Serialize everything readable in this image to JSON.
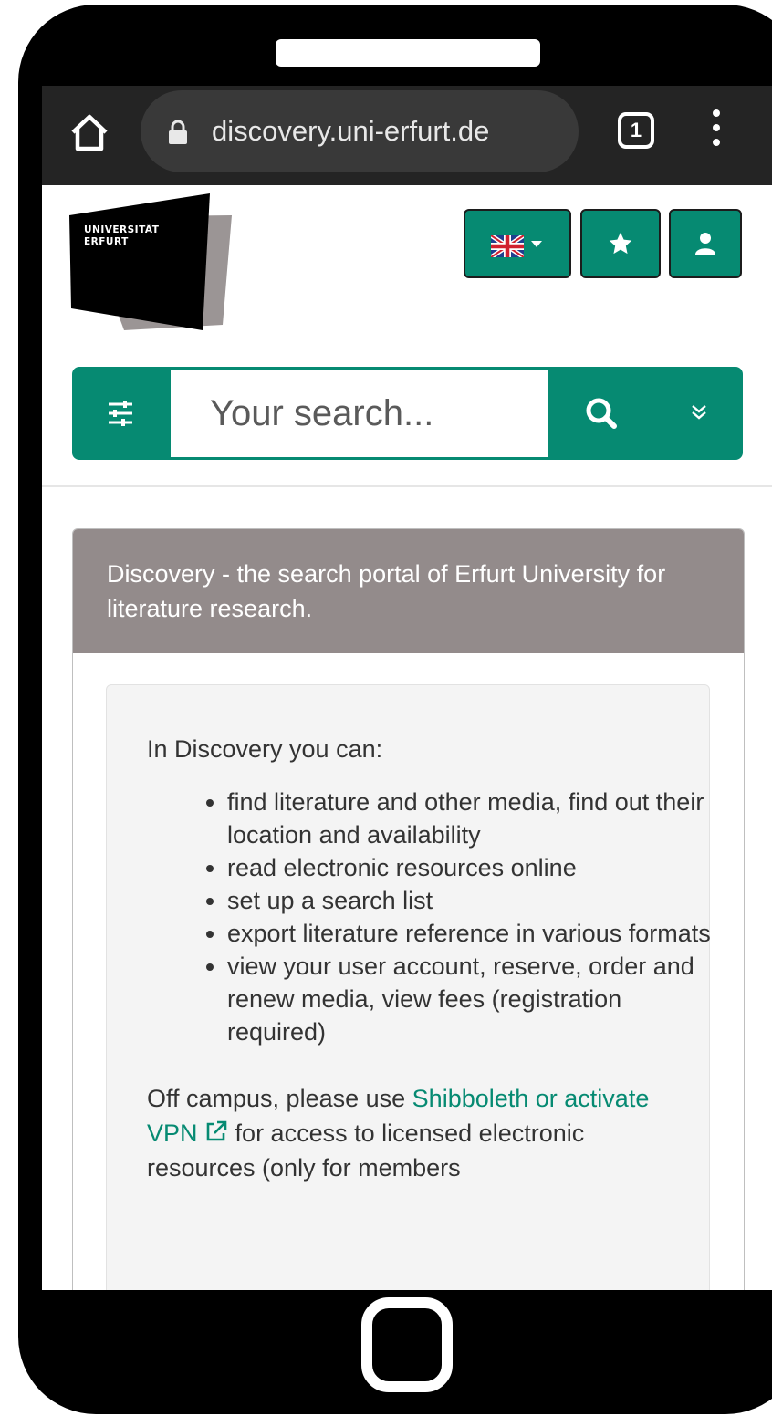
{
  "browser": {
    "url": "discovery.uni-erfurt.de",
    "tab_count": "1"
  },
  "header": {
    "logo_line1": "UNIVERSITÄT",
    "logo_line2": "ERFURT"
  },
  "search": {
    "placeholder": "Your search..."
  },
  "card": {
    "title": "Discovery - the search portal of Erfurt University for literature research.",
    "intro": "In Discovery you can:",
    "features": [
      "find literature and other media, find out their location and availability",
      "read electronic resources online",
      "set up a search list",
      "export literature reference in various formats",
      "view your user account, reserve, order and renew media, view fees (registration required)"
    ],
    "note_prefix": "Off campus, please use ",
    "note_link": "Shibboleth or activate VPN",
    "note_suffix": " for access to licensed electronic resources (only for members"
  },
  "colors": {
    "accent": "#068a72",
    "card_header": "#938b8b",
    "toolbar": "#242424"
  }
}
